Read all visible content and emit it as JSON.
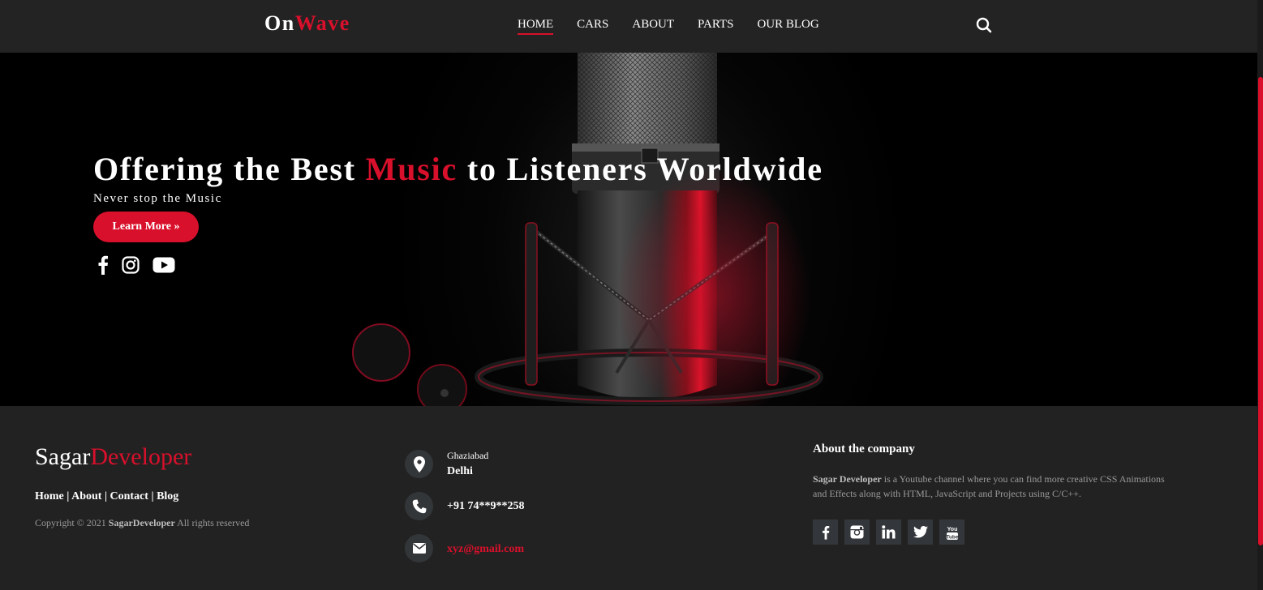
{
  "header": {
    "logo_part1": "On",
    "logo_part2": "Wave",
    "nav": [
      "HOME",
      "CARS",
      "ABOUT",
      "PARTS",
      "OUR BLOG"
    ],
    "active_nav": "HOME"
  },
  "hero": {
    "title_part1": "Offering the Best ",
    "title_highlight": "Music",
    "title_part2": " to Listeners Worldwide",
    "subtitle": "Never stop the Music",
    "cta_label": "Learn More »",
    "social_icons": [
      "facebook-icon",
      "instagram-icon",
      "youtube-icon"
    ]
  },
  "footer": {
    "logo_part1": "Sagar",
    "logo_part2": "Developer",
    "links": [
      "Home",
      "About",
      "Contact",
      "Blog"
    ],
    "copyright_prefix": "Copyright © 2021 ",
    "copyright_brand": "SagarDeveloper",
    "copyright_suffix": " All rights reserved",
    "contact": {
      "city": "Ghaziabad",
      "state": "Delhi",
      "phone": "+91 74**9**258",
      "email": "xyz@gmail.com"
    },
    "about_heading": "About the company",
    "about_brand": "Sagar Developer",
    "about_text": " is a Youtube channel where you can find more creative CSS Animations and Effects along with HTML, JavaScript and Projects using C/C++.",
    "social_icons": [
      "facebook-icon",
      "instagram-icon",
      "linkedin-icon",
      "twitter-icon",
      "youtube-icon"
    ]
  },
  "colors": {
    "accent": "#d9102b",
    "header_bg": "#232323",
    "footer_bg": "#222222"
  }
}
